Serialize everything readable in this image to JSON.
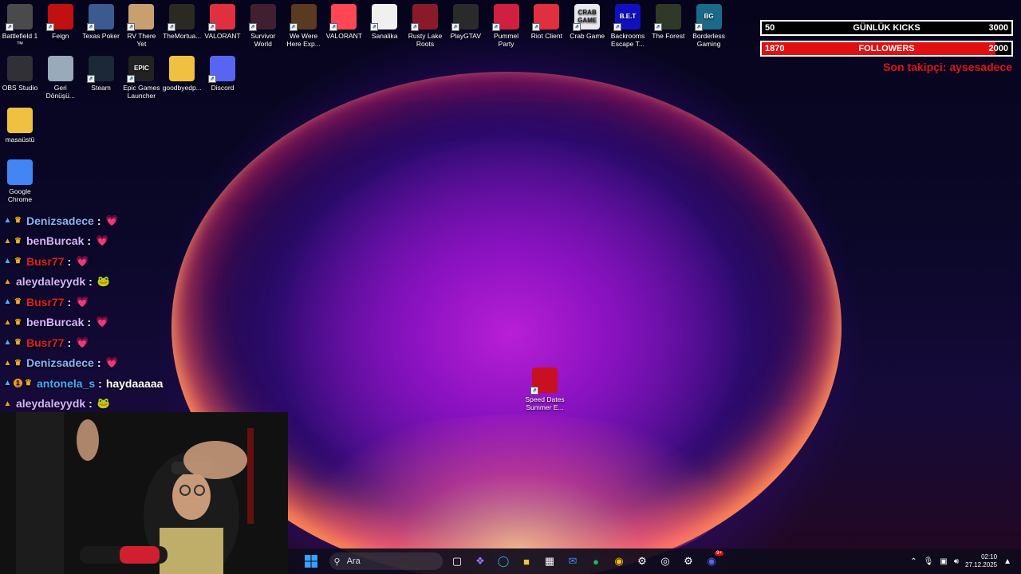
{
  "desktop": {
    "icons": [
      {
        "label": "Battlefield 1 ™",
        "color": "#4a4a4a"
      },
      {
        "label": "Feign",
        "color": "#c01010"
      },
      {
        "label": "Texas Poker",
        "color": "#3a5a90"
      },
      {
        "label": "RV There Yet",
        "color": "#c8a070"
      },
      {
        "label": "TheMortua...",
        "color": "#2a2a22"
      },
      {
        "label": "VALORANT",
        "color": "#e03040"
      },
      {
        "label": "Survivor World",
        "color": "#402030"
      },
      {
        "label": "We Were Here Exp...",
        "color": "#5a3a20"
      },
      {
        "label": "VALORANT",
        "color": "#ff4655"
      },
      {
        "label": "Sanalika",
        "color": "#f0f0f0"
      },
      {
        "label": "Rusty Lake Roots",
        "color": "#8a1a2a"
      },
      {
        "label": "PlayGTAV",
        "color": "#2a2a2a"
      },
      {
        "label": "Pummel Party",
        "color": "#d02040"
      },
      {
        "label": "Riot Client",
        "color": "#e03040"
      },
      {
        "label": "Crab Game",
        "color": "#e8e8f0"
      },
      {
        "label": "Backrooms Escape T...",
        "color": "#1010c0"
      },
      {
        "label": "The Forest",
        "color": "#303828"
      },
      {
        "label": "Borderless Gaming",
        "color": "#1a6a8a"
      },
      {
        "label": "OBS Studio",
        "color": "#303036"
      },
      {
        "label": "Geri Dönüşü...",
        "color": "#9ab"
      },
      {
        "label": "Steam",
        "color": "#1b2838"
      },
      {
        "label": "Epic Games Launcher",
        "color": "#222"
      },
      {
        "label": "goodbyedp...",
        "color": "#f0c040"
      },
      {
        "label": "Discord",
        "color": "#5865f2"
      },
      {
        "label": "masaüstü",
        "color": "#f0c040"
      },
      {
        "label": "Google Chrome",
        "color": "#4285f4"
      },
      {
        "label": "Speed Dates Summer E...",
        "color": "#c81020"
      }
    ],
    "icon_text": {
      "epic": "EPIC",
      "crab": "CRAB GAME",
      "bet": "B.E.T",
      "bg": "BG"
    }
  },
  "overlay": {
    "kicks": {
      "current": "50",
      "label": "GÜNLÜK KICKS",
      "goal": "3000",
      "progress": 0.0167,
      "color": "#000000"
    },
    "followers": {
      "current": "1870",
      "label": "FOLLOWERS",
      "goal": "2000",
      "progress": 0.935,
      "color": "#e01010"
    },
    "last_follower": "Son takipçi: aysesadece"
  },
  "chat": {
    "messages": [
      {
        "user": "Denizsadece",
        "text": "",
        "color": "#8ab4f8",
        "emote": "💗"
      },
      {
        "user": "benBurcak",
        "text": "",
        "color": "#d8b4ff",
        "emote": "💗"
      },
      {
        "user": "Busr77",
        "text": "",
        "color": "#e02020",
        "emote": "💗"
      },
      {
        "user": "aleydaleyydk",
        "text": "",
        "color": "#d8b4ff",
        "emote": "🐸"
      },
      {
        "user": "Busr77",
        "text": "",
        "color": "#e02020",
        "emote": "💗"
      },
      {
        "user": "benBurcak",
        "text": "",
        "color": "#d8b4ff",
        "emote": "💗"
      },
      {
        "user": "Busr77",
        "text": "",
        "color": "#e02020",
        "emote": "💗"
      },
      {
        "user": "Denizsadece",
        "text": "",
        "color": "#8ab4f8",
        "emote": "💗"
      },
      {
        "user": "antonela_s",
        "text": "haydaaaaa",
        "color": "#4aa8ff",
        "emote": ""
      },
      {
        "user": "aleydaleyydk",
        "text": "",
        "color": "#d8b4ff",
        "emote": "🐸"
      }
    ],
    "colon": ":"
  },
  "taskbar": {
    "search_placeholder": "Ara",
    "time": "02:10",
    "date": "27.12.2025",
    "discord_badge": "9+"
  }
}
